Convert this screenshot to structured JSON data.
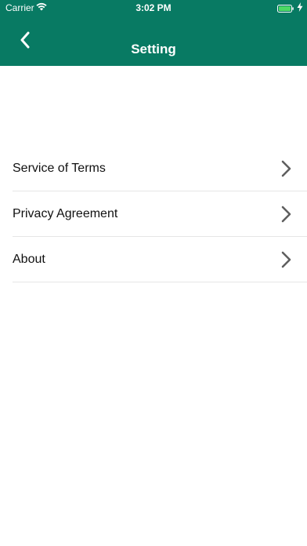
{
  "status_bar": {
    "carrier": "Carrier",
    "time": "3:02 PM"
  },
  "nav": {
    "title": "Setting",
    "back_icon": "chevron-left-icon"
  },
  "menu": {
    "items": [
      {
        "label": "Service of Terms",
        "icon": "chevron-right-icon"
      },
      {
        "label": "Privacy Agreement",
        "icon": "chevron-right-icon"
      },
      {
        "label": "About",
        "icon": "chevron-right-icon"
      }
    ]
  },
  "colors": {
    "header": "#087a63",
    "battery": "#4cd964",
    "chevron": "#5f5f5f"
  }
}
